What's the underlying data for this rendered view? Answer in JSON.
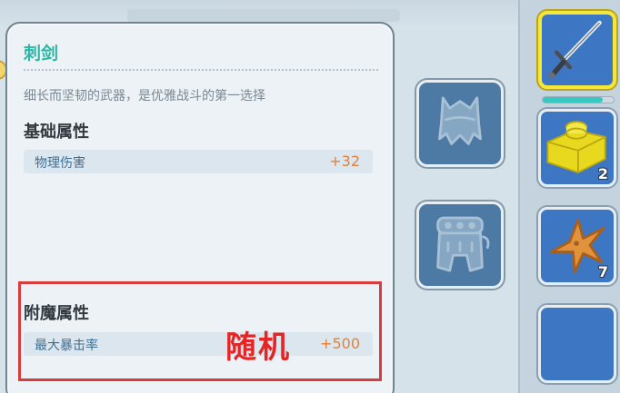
{
  "tooltip": {
    "item_name": "刺剑",
    "description": "细长而坚韧的武器，是优雅战斗的第一选择",
    "base_section_title": "基础属性",
    "base_stats": [
      {
        "label": "物理伤害",
        "value": "+32"
      }
    ],
    "enchant_section_title": "附魔属性",
    "enchant_stats": [
      {
        "label": "最大暴击率",
        "value": "+500"
      }
    ],
    "annotation": "随机"
  },
  "equipment_slots": [
    {
      "icon": "helmet-icon",
      "empty": true
    },
    {
      "icon": "armor-icon",
      "empty": true
    }
  ],
  "inventory": {
    "slots": [
      {
        "icon": "rapier-icon",
        "selected": true,
        "durability": 0.85
      },
      {
        "icon": "yellow-block-icon",
        "count": "2"
      },
      {
        "icon": "starfish-icon",
        "count": "7"
      },
      {
        "icon": "empty-slot",
        "empty": true
      }
    ]
  },
  "colors": {
    "item_name": "#2cb6a3",
    "stat_value": "#e4803a",
    "annotation": "#e52424",
    "selected_border": "#f5e63a",
    "slot_blue": "#3d76c3"
  }
}
